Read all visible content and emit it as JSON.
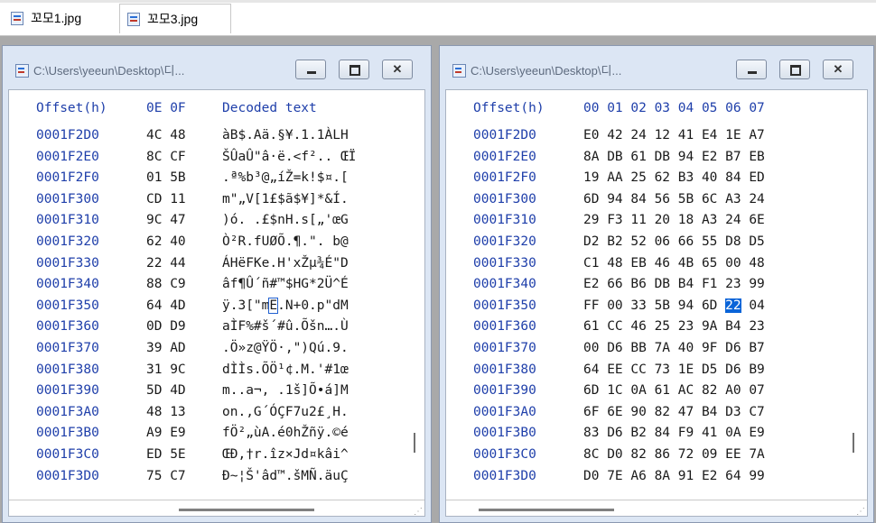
{
  "tabs": [
    {
      "label": "꼬모1.jpg",
      "icon": "hex-file-icon"
    },
    {
      "label": "꼬모3.jpg",
      "icon": "hex-file-icon"
    }
  ],
  "left_window": {
    "title": "C:\\Users\\yeeun\\Desktop\\디...",
    "header": {
      "offset": "Offset(h)",
      "cols": "0E 0F",
      "decoded": "Decoded text"
    },
    "rows": [
      {
        "offset": "0001F2D0",
        "hex": "4C 48",
        "text": "àB$.Aä.§¥.1.1ÀLH"
      },
      {
        "offset": "0001F2E0",
        "hex": "8C CF",
        "text": "ŠÛaÛ\"â·ë.<f².. ŒÏ"
      },
      {
        "offset": "0001F2F0",
        "hex": "01 5B",
        "text": ".ª%b³@„íŽ=k!$¤.["
      },
      {
        "offset": "0001F300",
        "hex": "CD 11",
        "text": "m\"„V[1£$ã$¥]*&Í."
      },
      {
        "offset": "0001F310",
        "hex": "9C 47",
        "text": ")ó. .£$nH.s[„'œG"
      },
      {
        "offset": "0001F320",
        "hex": "62 40",
        "text": "Ò²R.fUØÕ.¶.\". b@"
      },
      {
        "offset": "0001F330",
        "hex": "22 44",
        "text": "ÁHëFKe.H'xŽµ¾É\"D"
      },
      {
        "offset": "0001F340",
        "hex": "88 C9",
        "text": "âf¶Û´ñ#™$HG*2Ü^É"
      },
      {
        "offset": "0001F350",
        "hex": "64 4D",
        "text": "ÿ.3[\"m",
        "caret": "E",
        "text_after": ".N+0.p\"dM"
      },
      {
        "offset": "0001F360",
        "hex": "0D D9",
        "text": "aÌF%#š´#û.Õšn….Ù"
      },
      {
        "offset": "0001F370",
        "hex": "39 AD",
        "text": ".Ö»z@ŸÖ·,\")Qú.9."
      },
      {
        "offset": "0001F380",
        "hex": "31 9C",
        "text": "dÌÌs.ÕÖ¹¢.M.'#1œ"
      },
      {
        "offset": "0001F390",
        "hex": "5D 4D",
        "text": "m..a¬, .1š]Õ•á]M"
      },
      {
        "offset": "0001F3A0",
        "hex": "48 13",
        "text": "on.,G´ÓÇF7u2£¸H."
      },
      {
        "offset": "0001F3B0",
        "hex": "A9 E9",
        "text": "fÖ²„ùA.é0hŽñÿ.©é"
      },
      {
        "offset": "0001F3C0",
        "hex": "ED 5E",
        "text": "ŒÐ,†r.îz×Jd¤kâi^"
      },
      {
        "offset": "0001F3D0",
        "hex": "75 C7",
        "text": "Ð~¦Š'âd™.šMÑ.äuÇ"
      }
    ]
  },
  "right_window": {
    "title": "C:\\Users\\yeeun\\Desktop\\디...",
    "header": {
      "offset": "Offset(h)",
      "cols": "00 01 02 03 04 05 06 07"
    },
    "rows": [
      {
        "offset": "0001F2D0",
        "hex": "E0 42 24 12 41 E4 1E A7"
      },
      {
        "offset": "0001F2E0",
        "hex": "8A DB 61 DB 94 E2 B7 EB"
      },
      {
        "offset": "0001F2F0",
        "hex": "19 AA 25 62 B3 40 84 ED"
      },
      {
        "offset": "0001F300",
        "hex": "6D 94 84 56 5B 6C A3 24"
      },
      {
        "offset": "0001F310",
        "hex": "29 F3 11 20 18 A3 24 6E"
      },
      {
        "offset": "0001F320",
        "hex": "D2 B2 52 06 66 55 D8 D5"
      },
      {
        "offset": "0001F330",
        "hex": "C1 48 EB 46 4B 65 00 48"
      },
      {
        "offset": "0001F340",
        "hex": "E2 66 B6 DB B4 F1 23 99"
      },
      {
        "offset": "0001F350",
        "hex": "FF 00 33 5B 94 6D",
        "sel": "22",
        "hex_after": "04"
      },
      {
        "offset": "0001F360",
        "hex": "61 CC 46 25 23 9A B4 23"
      },
      {
        "offset": "0001F370",
        "hex": "00 D6 BB 7A 40 9F D6 B7"
      },
      {
        "offset": "0001F380",
        "hex": "64 EE CC 73 1E D5 D6 B9"
      },
      {
        "offset": "0001F390",
        "hex": "6D 1C 0A 61 AC 82 A0 07"
      },
      {
        "offset": "0001F3A0",
        "hex": "6F 6E 90 82 47 B4 D3 C7"
      },
      {
        "offset": "0001F3B0",
        "hex": "83 D6 B2 84 F9 41 0A E9"
      },
      {
        "offset": "0001F3C0",
        "hex": "8C D0 82 86 72 09 EE 7A"
      },
      {
        "offset": "0001F3D0",
        "hex": "D0 7E A6 8A 91 E2 64 99"
      }
    ]
  },
  "window_buttons": {
    "min": "",
    "max": "",
    "close": "✕"
  }
}
